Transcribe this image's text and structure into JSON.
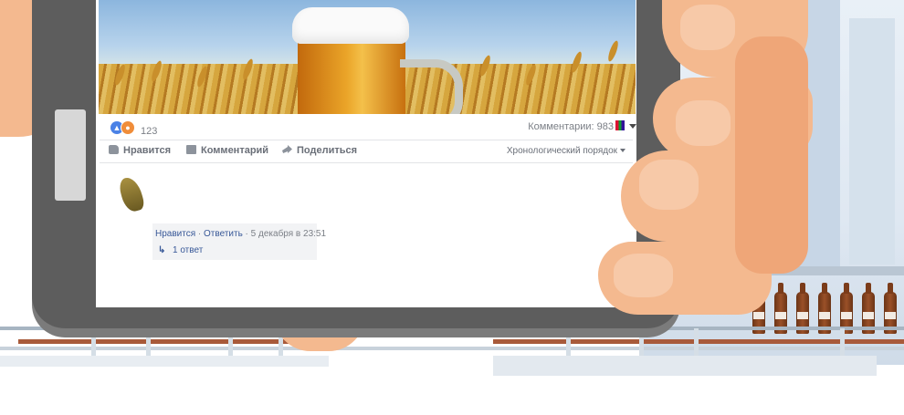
{
  "post": {
    "reactions": {
      "like_icon": "thumbs-up-icon",
      "angry_icon": "angry-face-icon",
      "count": "123"
    },
    "comments_label": "Комментарии: 983",
    "actions": {
      "like": "Нравится",
      "comment": "Комментарий",
      "share": "Поделиться"
    },
    "sort_label": "Хронологический порядок"
  },
  "comment": {
    "like": "Нравится",
    "sep": " · ",
    "reply": "Ответить",
    "time": "5 декабря в 23:51",
    "replies": "1 ответ"
  },
  "colors": {
    "link": "#385898",
    "muted": "#7b7f86",
    "skin": "#f4b98f"
  }
}
